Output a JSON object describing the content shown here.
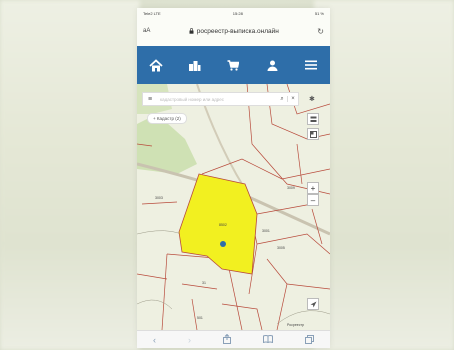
{
  "status_bar": {
    "carrier": "Tele2 LTE",
    "time": "15:28",
    "battery": "51 %"
  },
  "browser": {
    "text_size": "aA",
    "address": "росреестр-выписка.онлайн",
    "reload_icon": "reload-icon"
  },
  "navbar": {
    "bg": "#2e6ea9",
    "icons": [
      "home-icon",
      "buildings-icon",
      "cart-icon",
      "user-icon",
      "menu-icon"
    ]
  },
  "map": {
    "search_placeholder": "кадастровый номер или адрес",
    "layers_label": "+ Кадастр (2)",
    "parcel_labels": [
      "8502",
      "3001",
      "31",
      "3009",
      "3005",
      "3003",
      "501"
    ],
    "copyright": "Росреестр",
    "zoom_in": "+",
    "zoom_out": "–",
    "highlight_color": "#f2f020"
  },
  "bottom_bar": {
    "icons": [
      "back-icon",
      "forward-icon",
      "share-icon",
      "bookmarks-icon",
      "tabs-icon"
    ]
  }
}
